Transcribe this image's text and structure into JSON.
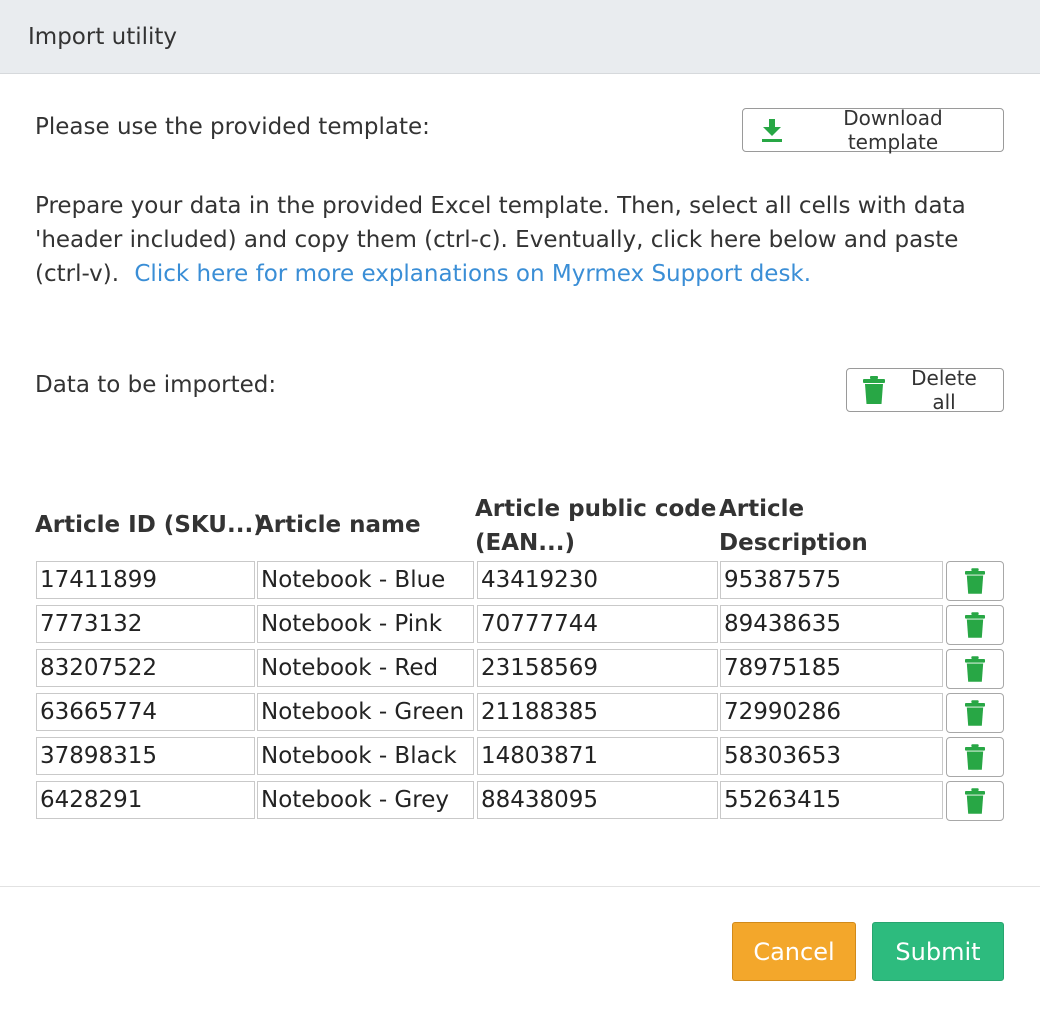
{
  "dialog": {
    "title": "Import utility"
  },
  "template": {
    "label": "Please use the provided template:",
    "download_button": "Download template",
    "download_icon": "download-icon"
  },
  "instructions": {
    "text": "Prepare your data in the provided Excel template. Then, select all cells with data 'header included) and copy them (ctrl-c). Eventually, click here below and paste (ctrl-v).",
    "link_text": "Click here for more explanations on Myrmex Support desk."
  },
  "data_section": {
    "label": "Data to be imported:",
    "delete_all_button": "Delete all",
    "delete_icon": "trash-icon"
  },
  "table": {
    "headers": {
      "article_id": "Article ID (SKU...)",
      "article_name": "Article name",
      "public_code_line1": "Article public code",
      "public_code_line2": "(EAN...)",
      "description_line1": "Article",
      "description_line2": "Description"
    },
    "rows": [
      {
        "id": "17411899",
        "name": "Notebook - Blue",
        "code": "43419230",
        "desc": "95387575"
      },
      {
        "id": "7773132",
        "name": "Notebook - Pink",
        "code": "70777744",
        "desc": "89438635"
      },
      {
        "id": "83207522",
        "name": "Notebook - Red",
        "code": "23158569",
        "desc": "78975185"
      },
      {
        "id": "63665774",
        "name": "Notebook - Green",
        "code": "21188385",
        "desc": "72990286"
      },
      {
        "id": "37898315",
        "name": "Notebook - Black",
        "code": "14803871",
        "desc": "58303653"
      },
      {
        "id": "6428291",
        "name": "Notebook - Grey",
        "code": "88438095",
        "desc": "55263415"
      }
    ]
  },
  "footer": {
    "cancel_button": "Cancel",
    "submit_button": "Submit"
  },
  "colors": {
    "accent_green": "#2dbb7e",
    "icon_green": "#28a745",
    "cancel_orange": "#f3a72b",
    "link_blue": "#3a8ed6",
    "header_bg": "#e9ecef"
  }
}
